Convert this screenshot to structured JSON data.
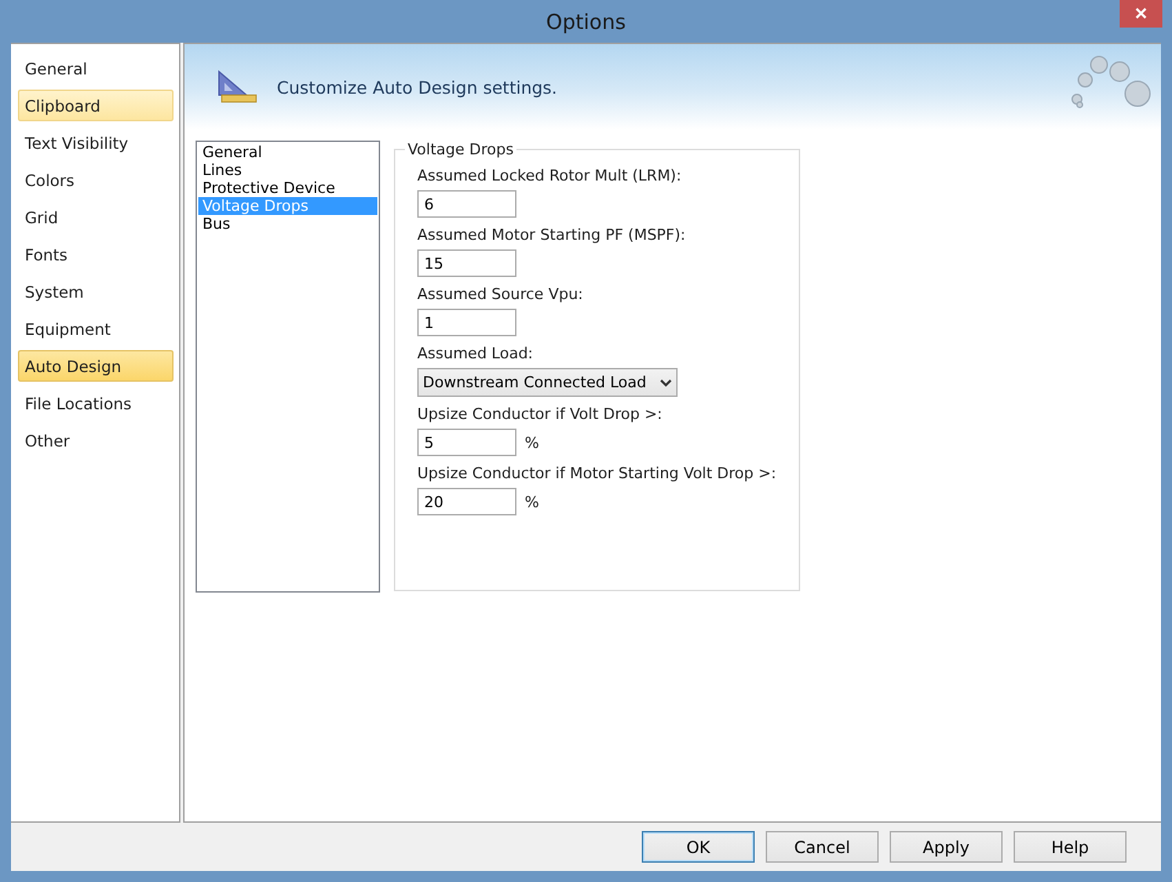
{
  "window": {
    "title": "Options",
    "close": "✕"
  },
  "sidebar": {
    "items": [
      {
        "label": "General",
        "selected": false,
        "hovered": false
      },
      {
        "label": "Clipboard",
        "selected": false,
        "hovered": true
      },
      {
        "label": "Text Visibility",
        "selected": false,
        "hovered": false
      },
      {
        "label": "Colors",
        "selected": false,
        "hovered": false
      },
      {
        "label": "Grid",
        "selected": false,
        "hovered": false
      },
      {
        "label": "Fonts",
        "selected": false,
        "hovered": false
      },
      {
        "label": "System",
        "selected": false,
        "hovered": false
      },
      {
        "label": "Equipment",
        "selected": false,
        "hovered": false
      },
      {
        "label": "Auto Design",
        "selected": true,
        "hovered": false
      },
      {
        "label": "File Locations",
        "selected": false,
        "hovered": false
      },
      {
        "label": "Other",
        "selected": false,
        "hovered": false
      }
    ]
  },
  "header": {
    "text": "Customize Auto Design settings."
  },
  "categories": [
    {
      "label": "General",
      "selected": false
    },
    {
      "label": "Lines",
      "selected": false
    },
    {
      "label": "Protective Device",
      "selected": false
    },
    {
      "label": "Voltage Drops",
      "selected": true
    },
    {
      "label": "Bus",
      "selected": false
    }
  ],
  "group": {
    "title": "Voltage Drops",
    "fields": [
      {
        "kind": "text",
        "label": "Assumed Locked Rotor Mult (LRM):",
        "value": "6"
      },
      {
        "kind": "text",
        "label": "Assumed Motor Starting PF (MSPF):",
        "value": "15"
      },
      {
        "kind": "text",
        "label": "Assumed Source Vpu:",
        "value": "1"
      },
      {
        "kind": "select",
        "label": "Assumed Load:",
        "value": "Downstream Connected Load"
      },
      {
        "kind": "text",
        "label": "Upsize Conductor if Volt Drop >:",
        "value": "5",
        "unit": "%"
      },
      {
        "kind": "text",
        "label": "Upsize Conductor if Motor Starting Volt Drop >:",
        "value": "20",
        "unit": "%"
      }
    ]
  },
  "buttons": [
    {
      "label": "OK",
      "default": true
    },
    {
      "label": "Cancel",
      "default": false
    },
    {
      "label": "Apply",
      "default": false
    },
    {
      "label": "Help",
      "default": false
    }
  ]
}
